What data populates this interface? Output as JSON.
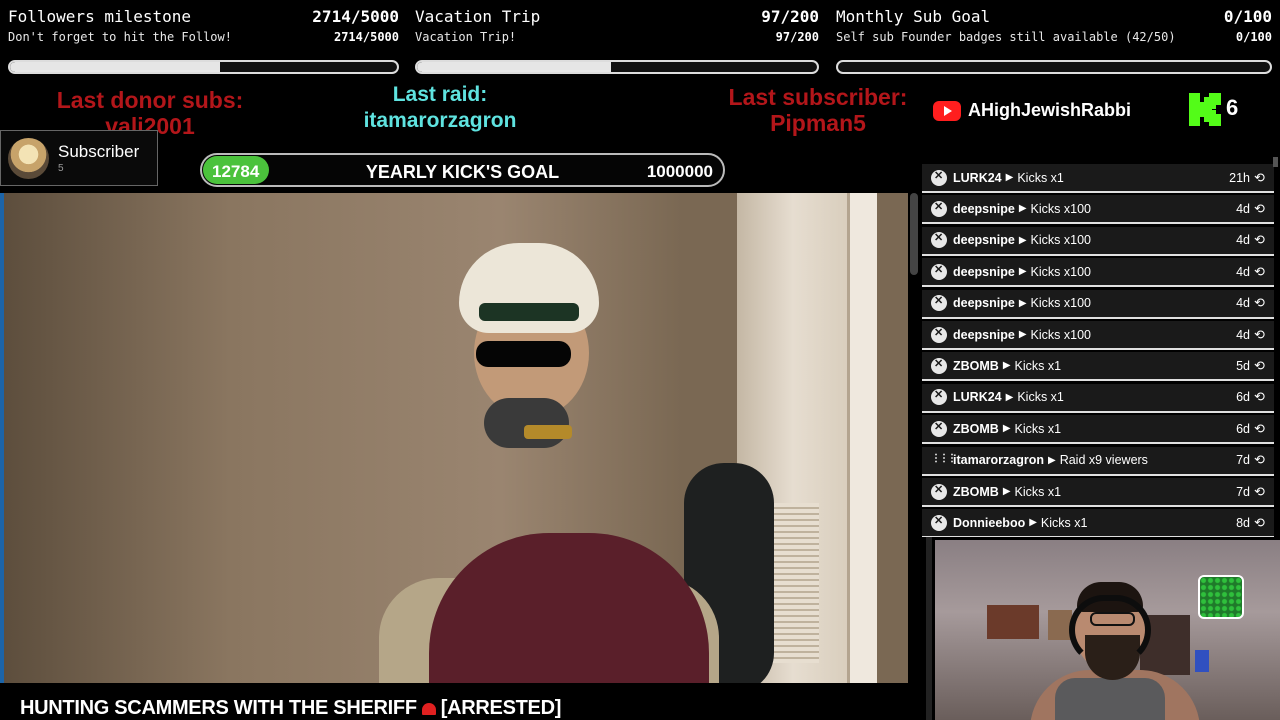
{
  "goals": [
    {
      "title": "Followers milestone",
      "subtitle": "Don't forget to hit the Follow!",
      "count": "2714/5000",
      "progress": 0.5428
    },
    {
      "title": "Vacation Trip",
      "subtitle": "Vacation Trip!",
      "count": "97/200",
      "progress": 0.485
    },
    {
      "title": "Monthly Sub Goal",
      "subtitle": "Self sub Founder badges still available (42/50)",
      "count": "0/100",
      "progress": 0.0
    }
  ],
  "last_donor": {
    "label": "Last donor subs:",
    "name": "vali2001"
  },
  "last_raid": {
    "label": "Last raid:",
    "name": "itamarorzagron"
  },
  "last_subscriber": {
    "label": "Last subscriber:",
    "name": "Pipman5"
  },
  "youtube": {
    "name": "AHighJewishRabbi"
  },
  "kick": {
    "count": "6"
  },
  "subscriber_card": {
    "label": "Subscriber",
    "count": "5"
  },
  "yearly_goal": {
    "current": "12784",
    "label": "YEARLY KICK'S GOAL",
    "target": "1000000"
  },
  "video": {
    "title_prefix": "HUNTING SCAMMERS WITH THE SHERIFF",
    "title_suffix": "[ARRESTED]"
  },
  "events": [
    {
      "name": "LURK24",
      "action": "Kicks x1",
      "time": "21h",
      "type": "kick"
    },
    {
      "name": "deepsnipe",
      "action": "Kicks x100",
      "time": "4d",
      "type": "kick"
    },
    {
      "name": "deepsnipe",
      "action": "Kicks x100",
      "time": "4d",
      "type": "kick"
    },
    {
      "name": "deepsnipe",
      "action": "Kicks x100",
      "time": "4d",
      "type": "kick"
    },
    {
      "name": "deepsnipe",
      "action": "Kicks x100",
      "time": "4d",
      "type": "kick"
    },
    {
      "name": "deepsnipe",
      "action": "Kicks x100",
      "time": "4d",
      "type": "kick"
    },
    {
      "name": "ZBOMB",
      "action": "Kicks x1",
      "time": "5d",
      "type": "kick"
    },
    {
      "name": "LURK24",
      "action": "Kicks x1",
      "time": "6d",
      "type": "kick"
    },
    {
      "name": "ZBOMB",
      "action": "Kicks x1",
      "time": "6d",
      "type": "kick"
    },
    {
      "name": "itamarorzagron",
      "action": "Raid x9 viewers",
      "time": "7d",
      "type": "raid"
    },
    {
      "name": "ZBOMB",
      "action": "Kicks x1",
      "time": "7d",
      "type": "kick"
    },
    {
      "name": "Donnieeboo",
      "action": "Kicks x1",
      "time": "8d",
      "type": "kick"
    }
  ],
  "colors": {
    "donor_red": "#b3161a",
    "raid_cyan": "#5fe3e0",
    "yearly_fill": "#4bc23c",
    "kick_green": "#53fc18",
    "youtube_red": "#ff1e1e"
  }
}
